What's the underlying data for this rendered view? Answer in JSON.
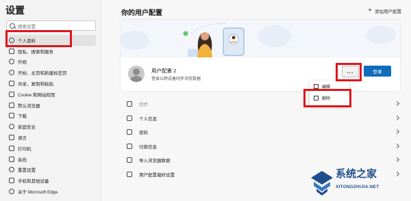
{
  "sidebar": {
    "title": "设置",
    "search_placeholder": "搜索设置",
    "items": [
      {
        "label": "个人资料",
        "icon": "person-icon",
        "active": true
      },
      {
        "label": "隐私、搜索和服务",
        "icon": "lock-icon"
      },
      {
        "label": "外观",
        "icon": "appearance-icon"
      },
      {
        "label": "开始、主页和新建标签页",
        "icon": "power-icon"
      },
      {
        "label": "共享、复制和粘贴",
        "icon": "share-icon"
      },
      {
        "label": "Cookie 和网站权限",
        "icon": "cookie-icon"
      },
      {
        "label": "默认浏览器",
        "icon": "browser-icon"
      },
      {
        "label": "下载",
        "icon": "download-icon"
      },
      {
        "label": "家庭安全",
        "icon": "family-icon"
      },
      {
        "label": "语言",
        "icon": "language-icon"
      },
      {
        "label": "打印机",
        "icon": "printer-icon"
      },
      {
        "label": "系统",
        "icon": "system-icon"
      },
      {
        "label": "重置设置",
        "icon": "reset-icon"
      },
      {
        "label": "手机和其他设备",
        "icon": "phone-icon"
      },
      {
        "label": "关于 Microsoft Edge",
        "icon": "edge-icon"
      }
    ]
  },
  "main": {
    "title": "你的用户配置",
    "add_profile": "添加用户配置",
    "profile": {
      "name": "用户配置 2",
      "subtitle": "登录以跨设备同步浏览数据",
      "more_label": "...",
      "login_label": "登录"
    },
    "context_menu": [
      {
        "label": "编辑",
        "icon": "pencil-icon"
      },
      {
        "label": "删除",
        "icon": "trash-icon"
      }
    ],
    "rows": [
      {
        "label": "同步",
        "icon": "sync-icon",
        "dim": true
      },
      {
        "label": "个人信息",
        "icon": "person-card-icon"
      },
      {
        "label": "密码",
        "icon": "key-icon"
      },
      {
        "label": "付款信息",
        "icon": "card-icon"
      },
      {
        "label": "导入浏览器数据",
        "icon": "import-icon"
      },
      {
        "label": "用户配置偏好设置",
        "icon": "profile-settings-icon"
      }
    ]
  },
  "watermark": {
    "title": "系统之家",
    "subtitle": "XITONGZHIJIA.NET"
  },
  "colors": {
    "accent": "#0f6cbd",
    "highlight": "#e0141b",
    "watermark": "#1f4f8c"
  }
}
